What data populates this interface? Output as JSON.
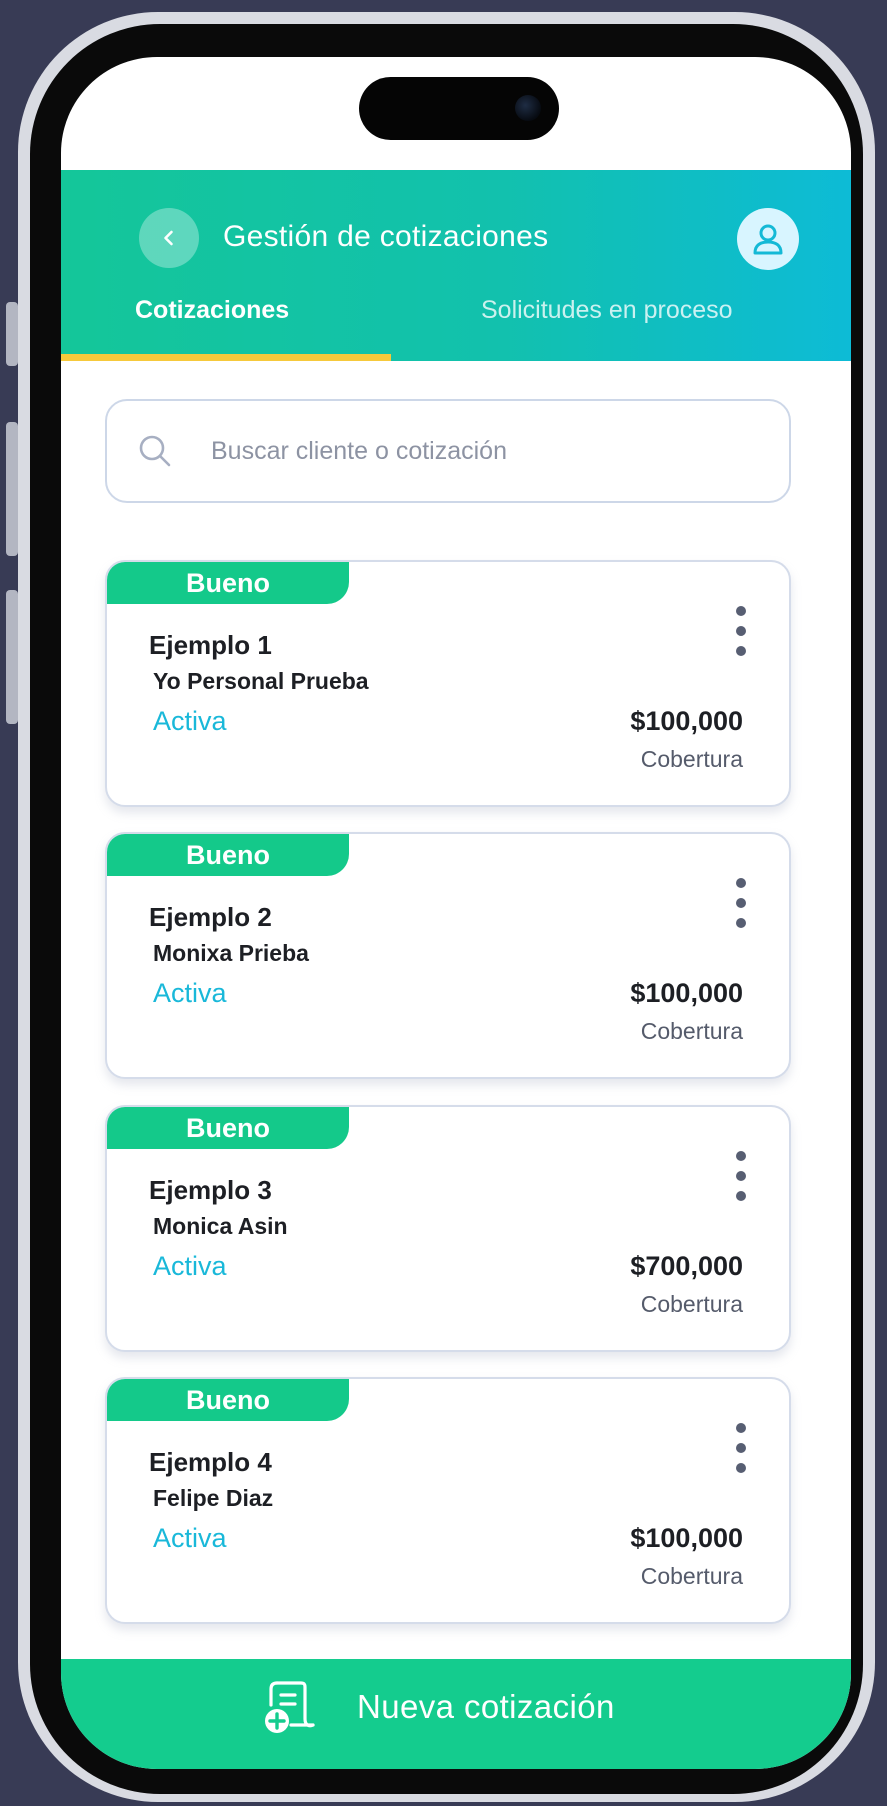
{
  "header": {
    "title": "Gestión de cotizaciones",
    "back_icon": "chevron-left-icon",
    "profile_icon": "user-icon"
  },
  "tabs": [
    {
      "label": "Cotizaciones",
      "active": true
    },
    {
      "label": "Solicitudes en proceso",
      "active": false
    }
  ],
  "search": {
    "placeholder": "Buscar cliente o cotización",
    "value": ""
  },
  "quotes": [
    {
      "badge": "Bueno",
      "title": "Ejemplo 1",
      "client": "Yo Personal Prueba",
      "status": "Activa",
      "amount": "$100,000",
      "amount_label": "Cobertura"
    },
    {
      "badge": "Bueno",
      "title": "Ejemplo 2",
      "client": "Monixa Prieba",
      "status": "Activa",
      "amount": "$100,000",
      "amount_label": "Cobertura"
    },
    {
      "badge": "Bueno",
      "title": "Ejemplo 3",
      "client": "Monica Asin",
      "status": "Activa",
      "amount": "$700,000",
      "amount_label": "Cobertura"
    },
    {
      "badge": "Bueno",
      "title": "Ejemplo 4",
      "client": "Felipe Diaz",
      "status": "Activa",
      "amount": "$100,000",
      "amount_label": "Cobertura"
    }
  ],
  "footer": {
    "new_quote_label": "Nueva cotización"
  },
  "colors": {
    "primary_green": "#14c98a",
    "header_gradient_start": "#14c699",
    "header_gradient_end": "#0dbbd6",
    "tab_indicator": "#f6c93b",
    "status_active": "#19b8d9"
  }
}
